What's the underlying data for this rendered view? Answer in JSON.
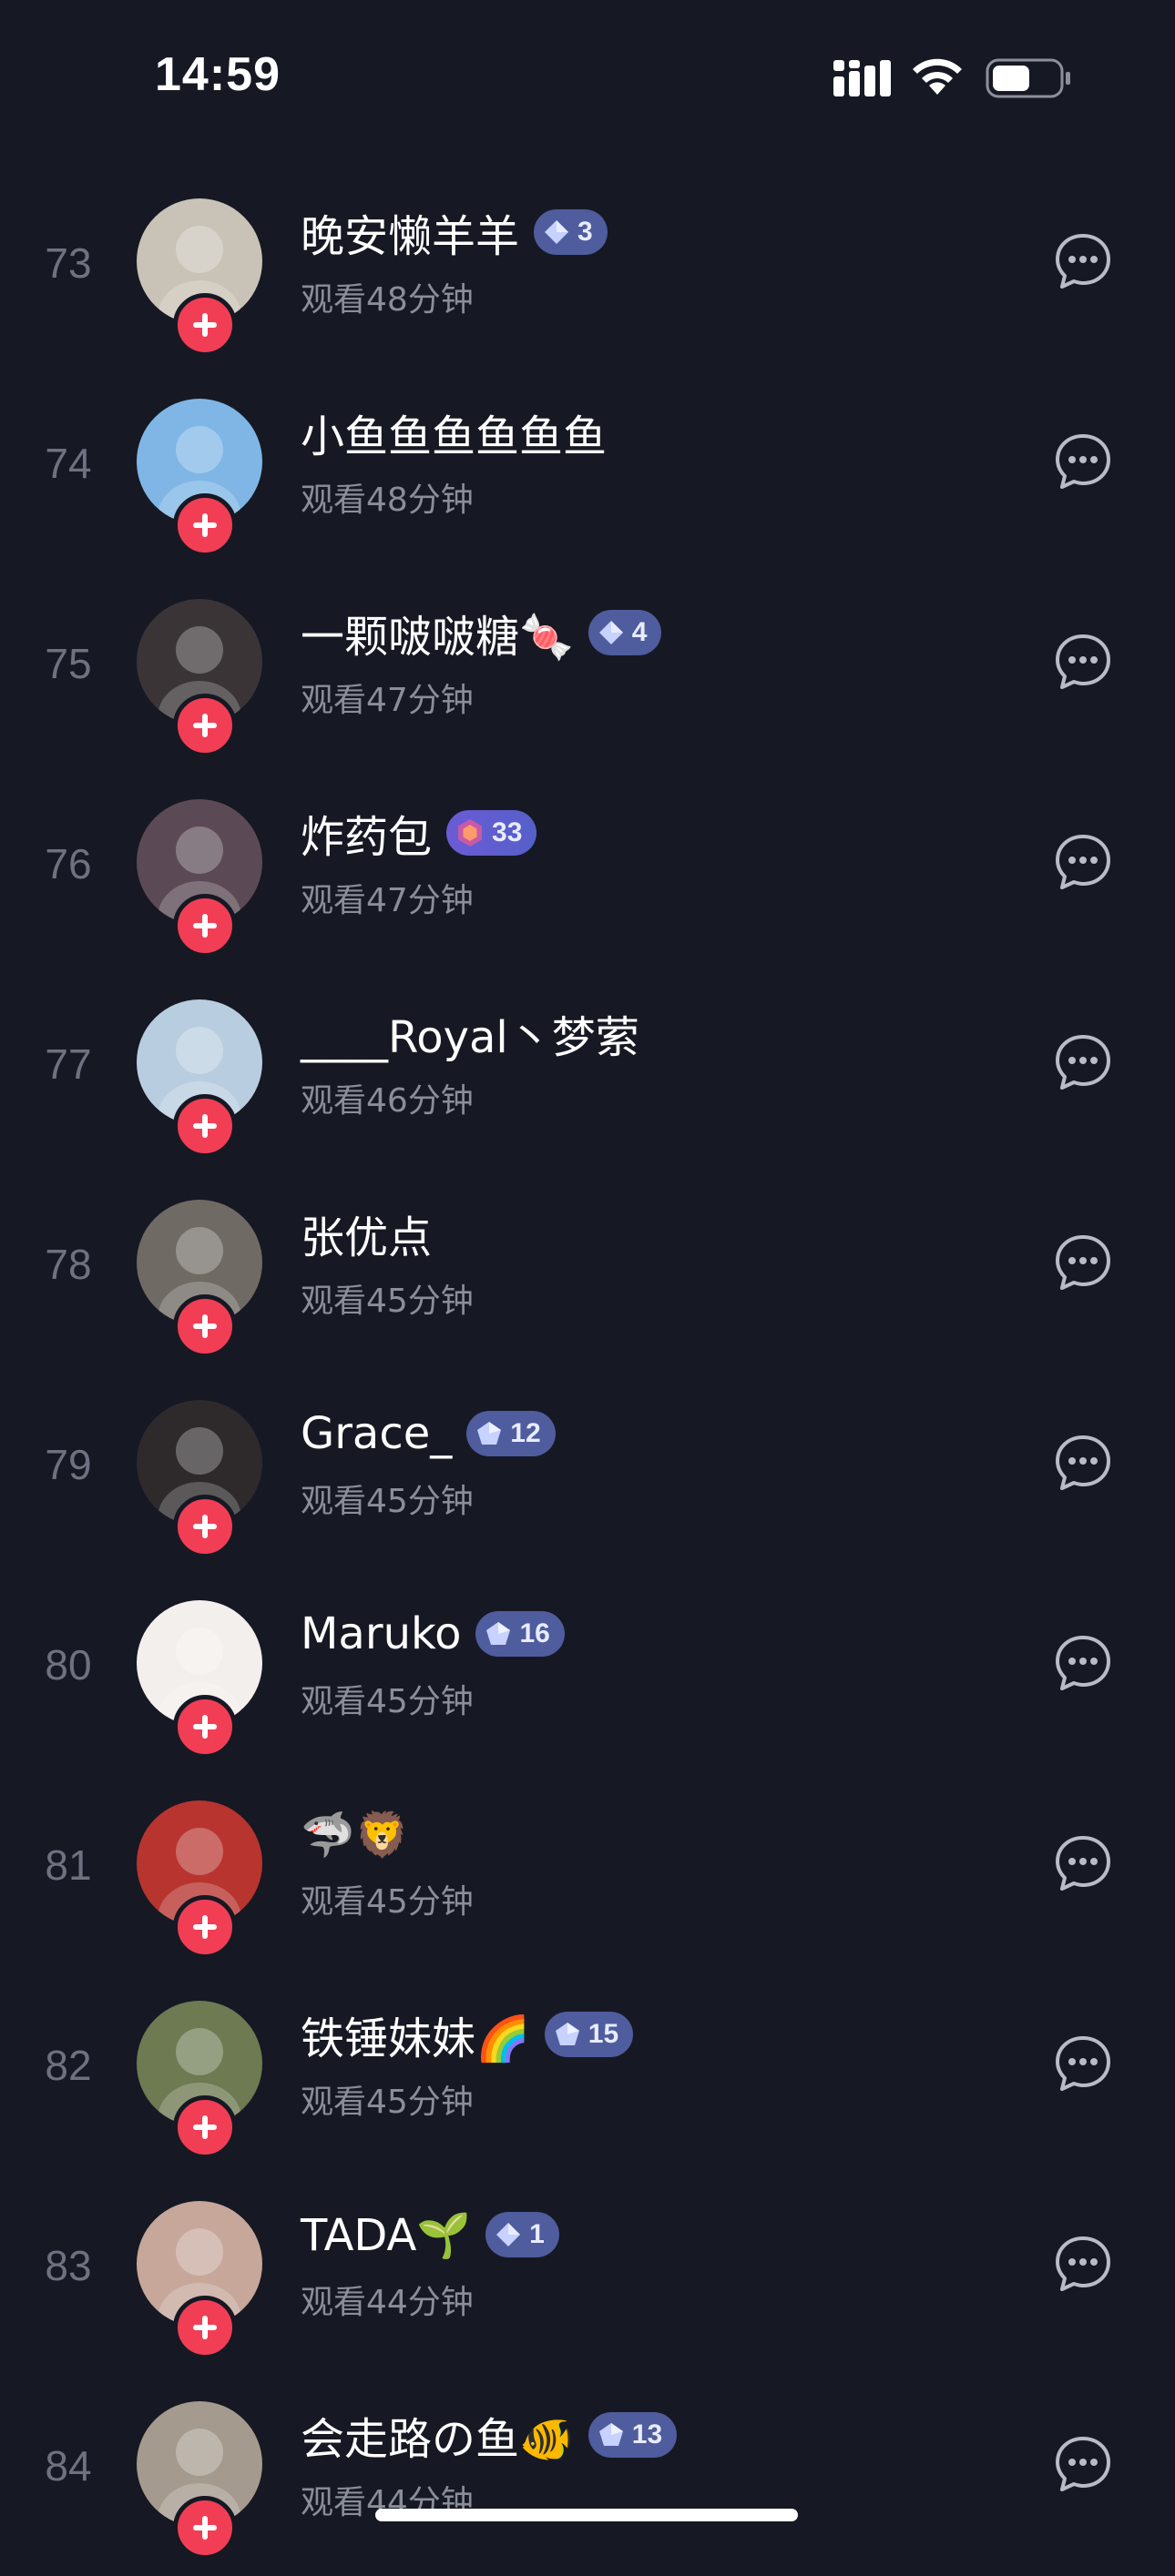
{
  "status_bar": {
    "time": "14:59",
    "signal_icon": "cellular-signal-icon",
    "wifi_icon": "wifi-icon",
    "battery_icon": "battery-icon"
  },
  "viewers": [
    {
      "rank": "73",
      "name": "晚安懒羊羊",
      "badge": "3",
      "badge_type": "diamond",
      "watch": "观看48分钟",
      "avatar_color": "#c9c2b6"
    },
    {
      "rank": "74",
      "name": "小鱼鱼鱼鱼鱼鱼",
      "badge": "",
      "badge_type": "",
      "watch": "观看48分钟",
      "avatar_color": "#7fb6e6"
    },
    {
      "rank": "75",
      "name": "一颗啵啵糖🍬",
      "badge": "4",
      "badge_type": "diamond",
      "watch": "观看47分钟",
      "avatar_color": "#3a3436"
    },
    {
      "rank": "76",
      "name": "炸药包",
      "badge": "33",
      "badge_type": "hex",
      "watch": "观看47分钟",
      "avatar_color": "#5b4a55"
    },
    {
      "rank": "77",
      "name": "____Royal丶梦萦",
      "badge": "",
      "badge_type": "",
      "watch": "观看46分钟",
      "avatar_color": "#b9cde0"
    },
    {
      "rank": "78",
      "name": "张优点",
      "badge": "",
      "badge_type": "",
      "watch": "观看45分钟",
      "avatar_color": "#6f6a63"
    },
    {
      "rank": "79",
      "name": "Grace_",
      "badge": "12",
      "badge_type": "pentagon",
      "watch": "观看45分钟",
      "avatar_color": "#2e2a2c"
    },
    {
      "rank": "80",
      "name": "Maruko",
      "badge": "16",
      "badge_type": "pentagon",
      "watch": "观看45分钟",
      "avatar_color": "#f3efec"
    },
    {
      "rank": "81",
      "name": "🦈🦁",
      "badge": "",
      "badge_type": "",
      "watch": "观看45分钟",
      "avatar_color": "#b8342f"
    },
    {
      "rank": "82",
      "name": "铁锤妹妹🌈",
      "badge": "15",
      "badge_type": "pentagon",
      "watch": "观看45分钟",
      "avatar_color": "#6d7a52"
    },
    {
      "rank": "83",
      "name": "TADA🌱",
      "badge": "1",
      "badge_type": "diamond",
      "watch": "观看44分钟",
      "avatar_color": "#c6a79a"
    },
    {
      "rank": "84",
      "name": "会走路の鱼🐠",
      "badge": "13",
      "badge_type": "pentagon",
      "watch": "观看44分钟",
      "avatar_color": "#a49a8e"
    }
  ]
}
